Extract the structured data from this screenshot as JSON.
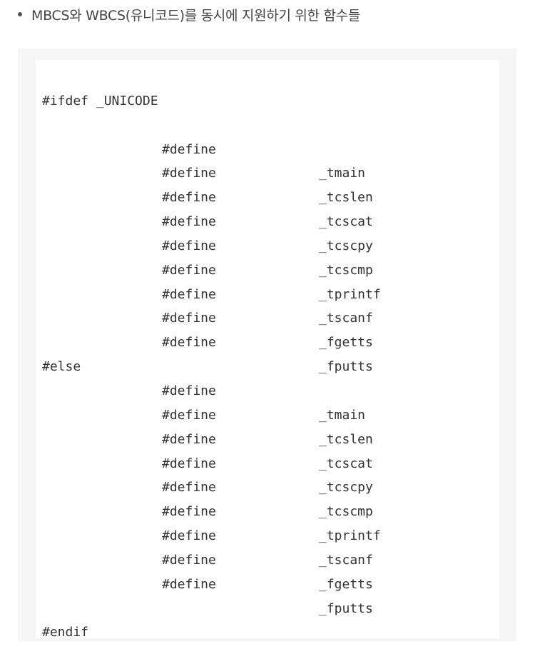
{
  "bullet": {
    "text": "MBCS와 WBCS(유니코드)를 동시에 지원하기 위한 함수들"
  },
  "code": {
    "ifdef": "#ifdef _UNICODE",
    "unicode_defines": [
      {
        "kw": "#define",
        "sym": "_tmain"
      },
      {
        "kw": "#define",
        "sym": "_tcslen"
      },
      {
        "kw": "#define",
        "sym": "_tcscat"
      },
      {
        "kw": "#define",
        "sym": "_tcscpy"
      },
      {
        "kw": "#define",
        "sym": "_tcscmp"
      },
      {
        "kw": "#define",
        "sym": "_tprintf"
      },
      {
        "kw": "#define",
        "sym": "_tscanf"
      },
      {
        "kw": "#define",
        "sym": "_fgetts"
      },
      {
        "kw": "#define",
        "sym": "_fputts"
      }
    ],
    "else": "#else",
    "else_defines": [
      {
        "kw": "#define",
        "sym": "_tmain"
      },
      {
        "kw": "#define",
        "sym": "_tcslen"
      },
      {
        "kw": "#define",
        "sym": "_tcscat"
      },
      {
        "kw": "#define",
        "sym": "_tcscpy"
      },
      {
        "kw": "#define",
        "sym": "_tcscmp"
      },
      {
        "kw": "#define",
        "sym": "_tprintf"
      },
      {
        "kw": "#define",
        "sym": "_tscanf"
      },
      {
        "kw": "#define",
        "sym": "_fgetts"
      },
      {
        "kw": "#define",
        "sym": "_fputts"
      }
    ],
    "endif": "#endif"
  }
}
